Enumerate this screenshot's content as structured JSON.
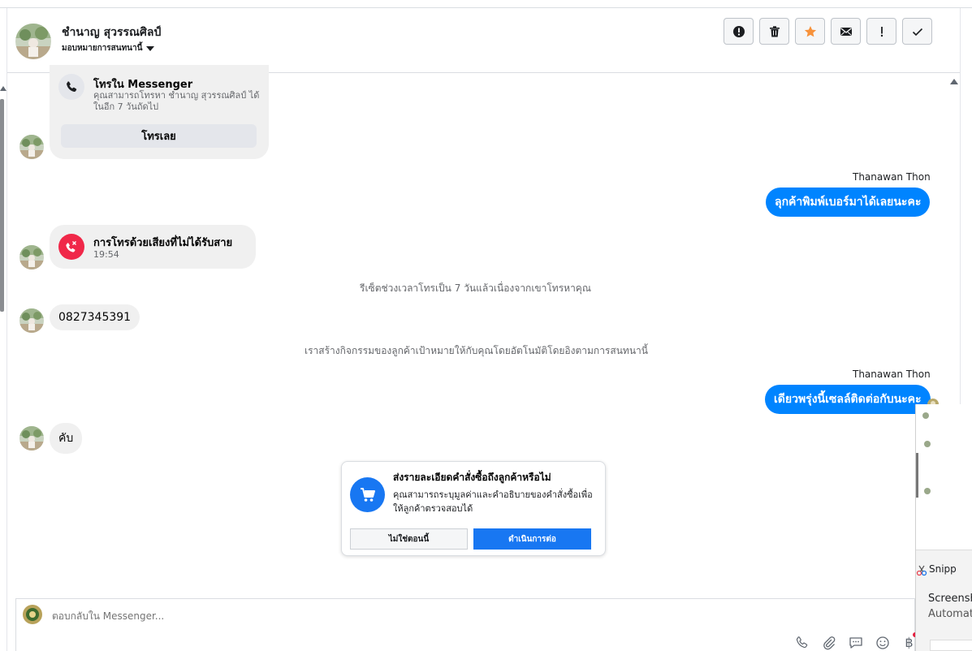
{
  "header": {
    "contact_name": "ชำนาญ สุวรรณศิลป์",
    "assign_label": "มอบหมายการสนทนานี้"
  },
  "actions": [
    {
      "name": "report-button",
      "icon": "alert-circle-icon"
    },
    {
      "name": "delete-button",
      "icon": "trash-icon"
    },
    {
      "name": "star-button",
      "icon": "star-icon"
    },
    {
      "name": "mark-unread-button",
      "icon": "envelope-icon"
    },
    {
      "name": "follow-up-button",
      "icon": "exclamation-icon"
    },
    {
      "name": "mark-done-button",
      "icon": "check-icon"
    }
  ],
  "colors": {
    "messenger_blue": "#0084ff",
    "primary_blue": "#1877f2",
    "missed_red": "#f02849",
    "star_orange": "#f7923b"
  },
  "call_card": {
    "title": "โทรใน Messenger",
    "description": "คุณสามารถโทรหา ชำนาญ สุวรรณศิลป์ ได้ในอีก 7 วันถัดไป",
    "button": "โทรเลย"
  },
  "messages": {
    "sender_1": "Thanawan Thon",
    "out_1": "ลุกค้าพิมพ์เบอร์มาได้เลยนะคะ",
    "missed_title": "การโทรด้วยเสียงที่ไม่ได้รับสาย",
    "missed_time": "19:54",
    "sys_1": "รีเซ็ตช่วงเวลาโทรเป็น 7 วันแล้วเนื่องจากเขาโทรหาคุณ",
    "in_phone": "0827345391",
    "sys_2": "เราสร้างกิจกรรมของลูกค้าเป้าหมายให้กับคุณโดยอัตโนมัติโดยอิงตามการสนทนานี้",
    "sender_2": "Thanawan Thon",
    "out_2": "เดียวพรุ่งนี้เซลล์ติดต่อกับนะคะ",
    "in_reply": "คับ"
  },
  "order_card": {
    "title": "ส่งรายละเอียดคำสั่งซื้อถึงลูกค้าหรือไม่",
    "description": "คุณสามารถระบุมูลค่าและคำอธิบายของคำสั่งซื้อเพื่อให้ลูกค้าตรวจสอบได้",
    "secondary": "ไม่ใช่ตอนนี้",
    "primary": "ดำเนินการต่อ"
  },
  "composer": {
    "placeholder": "ตอบกลับใน Messenger..."
  },
  "snip": {
    "app": "Snipp",
    "title": "Screensh",
    "subtitle": "Automat"
  },
  "currency_symbol": "฿"
}
